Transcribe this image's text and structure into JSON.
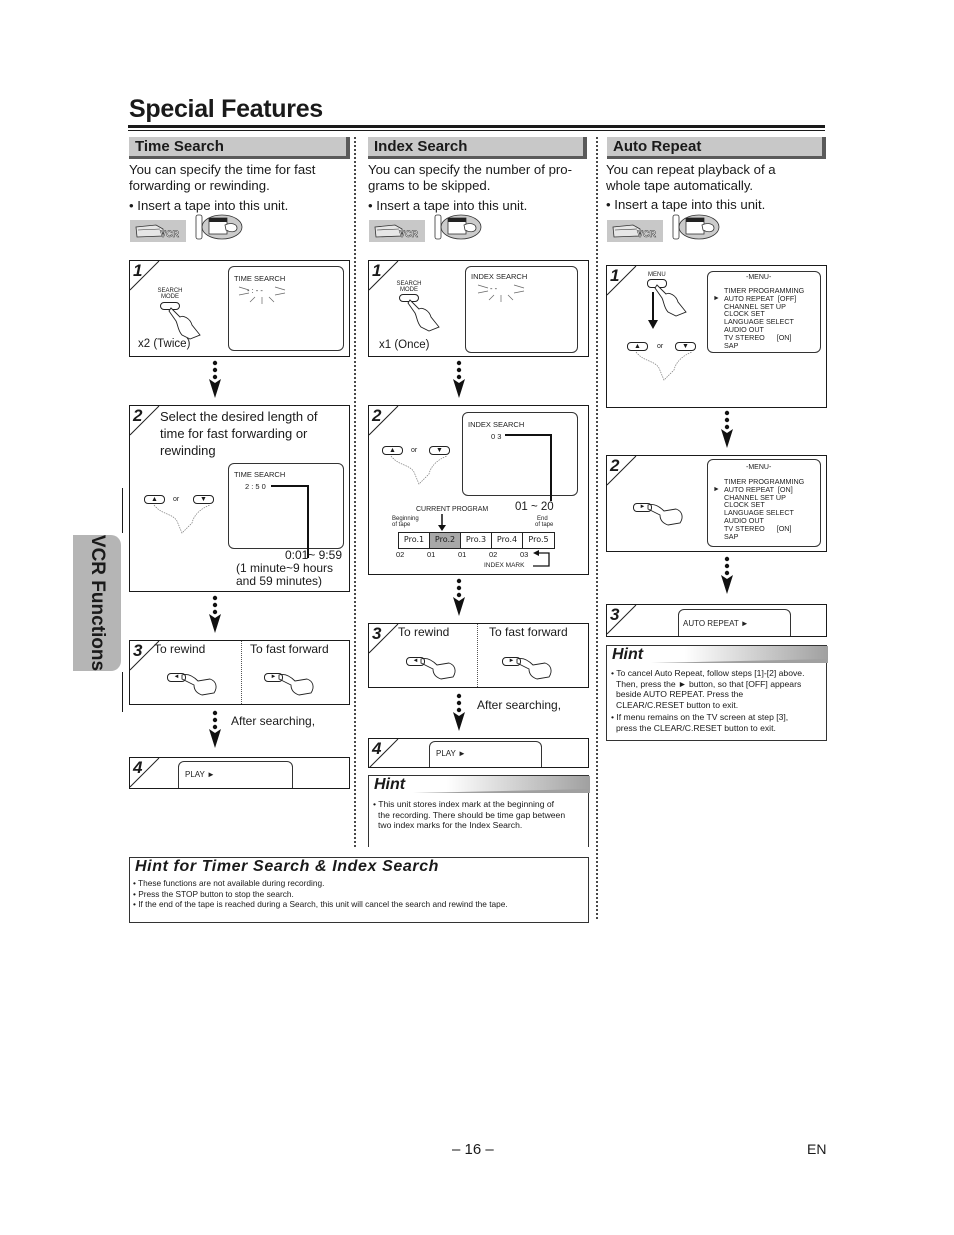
{
  "page": {
    "title": "Special Features",
    "side_tab": "VCR Functions",
    "page_number": "– 16 –",
    "language": "EN"
  },
  "icons": {
    "vcr_badge": "vcr-mode-badge-icon",
    "remote_vcr": "remote-vcr-button-icon",
    "hand": "pressing-hand-icon",
    "flow": "down-arrow-icon"
  },
  "time_search": {
    "heading": "Time Search",
    "intro_line1": "You can specify the time for fast",
    "intro_line2": "forwarding or rewinding.",
    "bullet": "• Insert a tape into this unit.",
    "vcr_label": "VCR",
    "step1": {
      "num": "1",
      "button_label_1": "SEARCH",
      "button_label_2": "MODE",
      "screen_title": "TIME SEARCH",
      "screen_value": "- : - -",
      "caption": "x2 (Twice)"
    },
    "step2": {
      "num": "2",
      "instruction_1": "Select the desired length of",
      "instruction_2": "time for fast forwarding or",
      "instruction_3": "rewinding",
      "or_label": "or",
      "screen_title": "TIME SEARCH",
      "screen_value": "2 : 5 0",
      "range": "0:01~ 9:59",
      "range_note_1": "(1 minute~9 hours",
      "range_note_2": "and 59 minutes)"
    },
    "step3": {
      "num": "3",
      "rewind_label": "To rewind",
      "forward_label": "To fast forward"
    },
    "after_label": "After searching,",
    "step4": {
      "num": "4",
      "screen_text": "PLAY ►"
    }
  },
  "index_search": {
    "heading": "Index Search",
    "intro_line1": "You can specify the number of pro-",
    "intro_line2": "grams to be skipped.",
    "bullet": "• Insert a tape into this unit.",
    "vcr_label": "VCR",
    "step1": {
      "num": "1",
      "button_label_1": "SEARCH",
      "button_label_2": "MODE",
      "screen_title": "INDEX SEARCH",
      "screen_value": "- -",
      "caption": "x1 (Once)"
    },
    "step2": {
      "num": "2",
      "or_label": "or",
      "screen_title": "INDEX SEARCH",
      "screen_value": "0 3",
      "range": "01 ~ 20",
      "current_program": "CURRENT PROGRAM",
      "beginning_1": "Beginning",
      "beginning_2": "of tape",
      "end_1": "End",
      "end_2": "of tape",
      "programs": [
        "Pro.1",
        "Pro.2",
        "Pro.3",
        "Pro.4",
        "Pro.5"
      ],
      "current_index": 1,
      "marks": [
        "02",
        "01",
        "01",
        "02",
        "03"
      ],
      "index_mark_label": "INDEX MARK"
    },
    "step3": {
      "num": "3",
      "rewind_label": "To rewind",
      "forward_label": "To fast forward"
    },
    "after_label": "After searching,",
    "step4": {
      "num": "4",
      "screen_text": "PLAY ►"
    },
    "hint": {
      "title": "Hint",
      "line1": "• This unit stores index mark at the beginning of",
      "line2": "the recording. There should be time gap between",
      "line3": "two index marks for the Index Search."
    }
  },
  "auto_repeat": {
    "heading": "Auto Repeat",
    "intro_line1": "You can repeat playback of a",
    "intro_line2": "whole tape automatically.",
    "bullet": "• Insert a tape into this unit.",
    "vcr_label": "VCR",
    "step1": {
      "num": "1",
      "button_label": "MENU",
      "or_label": "or",
      "menu_title": "-MENU-",
      "menu_items": [
        "TIMER PROGRAMMING",
        "AUTO REPEAT  [OFF]",
        "CHANNEL SET UP",
        "CLOCK SET",
        "LANGUAGE SELECT",
        "AUDIO OUT",
        "TV STEREO      [ON]",
        "SAP"
      ],
      "cursor": "►"
    },
    "step2": {
      "num": "2",
      "menu_title": "-MENU-",
      "menu_items": [
        "TIMER PROGRAMMING",
        "AUTO REPEAT  [ON]",
        "CHANNEL SET UP",
        "CLOCK SET",
        "LANGUAGE SELECT",
        "AUDIO OUT",
        "TV STEREO      [ON]",
        "SAP"
      ],
      "cursor": "►"
    },
    "step3": {
      "num": "3",
      "screen_text": "AUTO REPEAT ►"
    },
    "hint": {
      "title": "Hint",
      "b1_l1": "• To cancel Auto Repeat, follow steps [1]-[2] above.",
      "b1_l2": "Then, press the ► button, so that [OFF] appears",
      "b1_l3": "beside AUTO REPEAT.  Press the",
      "b1_l4": "CLEAR/C.RESET button to exit.",
      "b2_l1": "• If menu remains on the TV screen at step [3],",
      "b2_l2": "press the CLEAR/C.RESET button to exit."
    }
  },
  "bottom_hint": {
    "title": "Hint for Timer Search & Index Search",
    "items": [
      "• These functions are not available during recording.",
      "• Press the STOP button to stop the search.",
      "• If the end of the tape is reached during a Search, this unit will cancel the search and rewind the tape."
    ]
  }
}
